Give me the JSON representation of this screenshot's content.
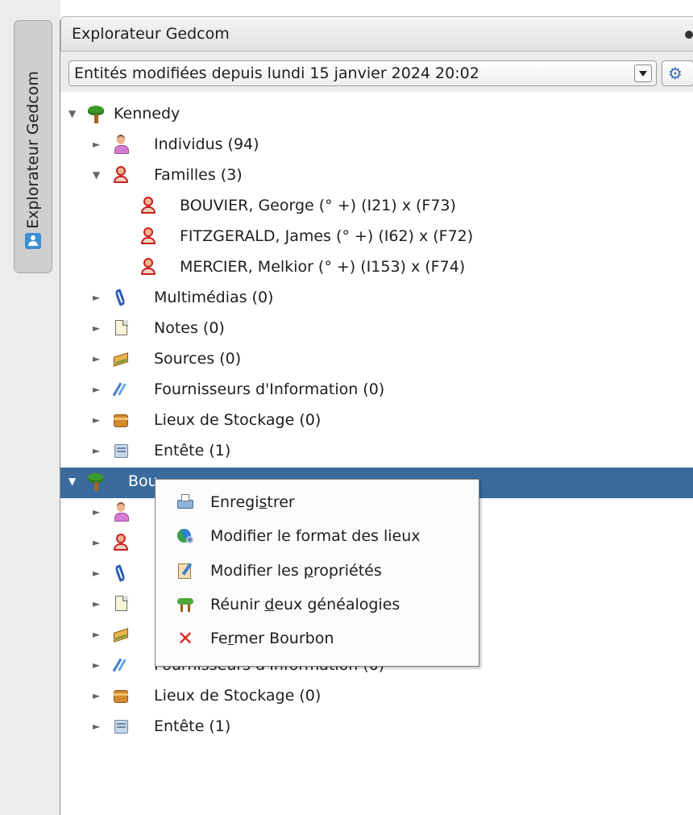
{
  "sidebar": {
    "tab_label": "Explorateur Gedcom",
    "tab_icon": "user-card-icon"
  },
  "panel": {
    "title": "Explorateur Gedcom"
  },
  "filter": {
    "value": "Entités modifiées depuis lundi 15 janvier 2024 20:02",
    "settings_icon": "gear-icon"
  },
  "tree": {
    "kennedy": {
      "label": "Kennedy",
      "individus": "Individus (94)",
      "familles": "Familles (3)",
      "families": [
        "BOUVIER, George (° +) (I21) x  (F73)",
        "FITZGERALD, James (° +) (I62) x  (F72)",
        "MERCIER, Melkior (° +) (I153) x  (F74)"
      ],
      "multimedias": "Multimédias (0)",
      "notes": "Notes (0)",
      "sources": "Sources (0)",
      "fournisseurs": "Fournisseurs d'Information (0)",
      "lieux": "Lieux de Stockage (0)",
      "entete": "Entête (1)"
    },
    "bourbon": {
      "label": "Bou",
      "fournisseurs_partial": "Fournisseurs d'Information (0)",
      "lieux": "Lieux de Stockage (0)",
      "entete": "Entête (1)"
    }
  },
  "context_menu": {
    "save": {
      "before": "Enregi",
      "mnemonic": "s",
      "after": "trer"
    },
    "places": "Modifier le format des lieux",
    "props": {
      "before": "Modifier les ",
      "mnemonic": "p",
      "after": "ropriétés"
    },
    "merge": {
      "before": "Réunir ",
      "mnemonic": "d",
      "after": "eux généalogies"
    },
    "close": {
      "before": "Fe",
      "mnemonic": "r",
      "after": "mer Bourbon"
    }
  },
  "colors": {
    "selection": "#3a6b9c",
    "close_icon": "#d8231f"
  }
}
